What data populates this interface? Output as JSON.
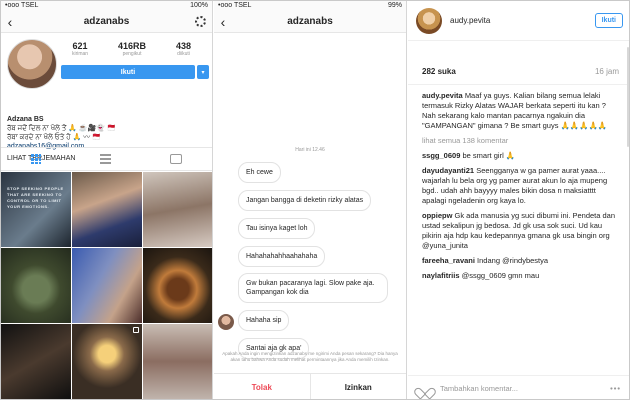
{
  "profile_screen": {
    "status": {
      "carrier": "•ooo TSEL",
      "battery": "100%"
    },
    "nav": {
      "back": "‹",
      "username": "adzanabs"
    },
    "stats": [
      {
        "value": "621",
        "label": "kiriman"
      },
      {
        "value": "416RB",
        "label": "pengikut"
      },
      {
        "value": "438",
        "label": "diikuti"
      }
    ],
    "follow_label": "Ikuti",
    "dropdown": "▾",
    "bio": {
      "name": "Adzana BS",
      "line1": "ਰੱਬ ਜਦੋਂ ਦਿਲ ਨਾ ਖੋਲੇ ਤੋਂ 🙏 ☕🎥👻 🇲🇨",
      "line2": "ਰੱਬਾ ਕਰਦੇ ਨਾ ਖੋਲੇ ਓਤੇ ਹੋ 🙏 〰 🇲🇨",
      "email": "adzanabs16@gmail.com",
      "translate": "LIHAT TERJEMAHAN"
    },
    "photo_text": "STOP SEEKING PEOPLE THAT ARE SEEKING TO CONTROL OR TO LIMIT YOUR EMOTIONS."
  },
  "chat_screen": {
    "status": {
      "carrier": "•ooo TSEL",
      "battery": "99%"
    },
    "nav": {
      "back": "‹",
      "username": "adzanabs"
    },
    "time": "Hari ini 12.46",
    "messages": [
      "Eh cewe",
      "Jangan bangga di deketin rizky alatas",
      "Tau isinya kaget loh",
      "Hahahahahhaahahaha",
      "Gw bukan pacaranya lagi. Slow pake aja. Gampangan kok dia",
      "Hahaha sip",
      "Santai aja gk apa'"
    ],
    "request_text": "Apakah Anda ingin mengizinkan adzanabs me ngirimi Anda pesan sekarang? Dia hanya akan tahu bahwa Anda sudah melihat permintaannya jika Anda memilih Izinkan.",
    "decline": "Tolak",
    "allow": "Izinkan"
  },
  "post_screen": {
    "username": "audy.pevita",
    "follow_label": "Ikuti",
    "likes": "282 suka",
    "ago": "16 jam",
    "caption_user": "audy.pevita",
    "caption": "Maaf ya guys. Kalian bilang semua lelaki termasuk Rizky Alatas WAJAR berkata seperti itu kan ? Nah sekarang kalo mantan pacarnya ngakuin dia \"GAMPANGAN\" gimana ? Be smart guys 🙏🙏🙏🙏🙏",
    "view_all": "lihat semua 138 komentar",
    "comments": [
      {
        "user": "ssgg_0609",
        "text": "be smart girl 🙏"
      },
      {
        "user": "dayudayanti21",
        "text": "Seengganya w ga pamer aurat yaaa.... wajarlah lu bela org yg pamer aurat akun lo aja mupeng bgd.. udah ahh bayyyy males bikin dosa n maksiatttt apalagi ngeladenin org kaya lo."
      },
      {
        "user": "oppiepw",
        "text": "Gk ada manusia yg suci dibumi ini. Pendeta dan ustad sekalipun jg bedosa. Jd gk usa sok suci. Ud kau pikirin aja hdp kau kedepannya gmana gk usa bingin org @yuna_junita"
      },
      {
        "user": "fareeha_ravani",
        "text": "Indang @rindybestya"
      },
      {
        "user": "naylafitriis",
        "text": "@ssgg_0609 gmn mau"
      }
    ],
    "add_comment": "Tambahkan komentar...",
    "more": "•••"
  }
}
